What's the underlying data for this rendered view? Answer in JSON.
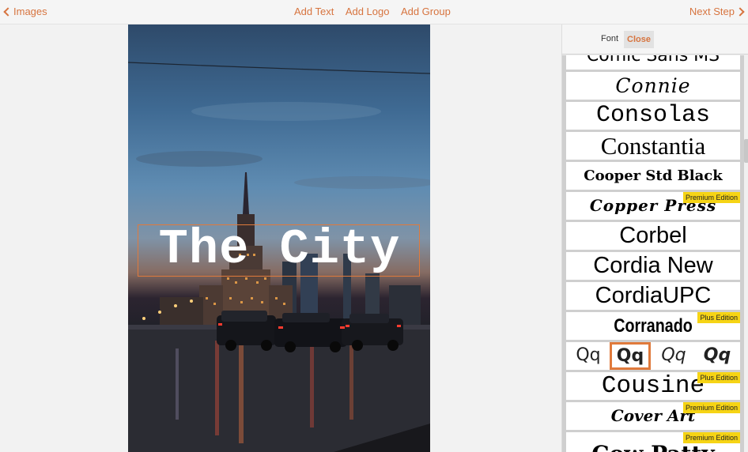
{
  "topbar": {
    "back_label": "Images",
    "actions": [
      "Add Text",
      "Add Logo",
      "Add Group"
    ],
    "next_label": "Next Step"
  },
  "canvas": {
    "text": "The City"
  },
  "panel": {
    "font_label": "Font",
    "close_label": "Close"
  },
  "fonts": [
    {
      "name": "Comic Sans MS",
      "badge": ""
    },
    {
      "name": "Connie",
      "badge": ""
    },
    {
      "name": "Consolas",
      "badge": ""
    },
    {
      "name": "Constantia",
      "badge": ""
    },
    {
      "name": "Cooper Std Black",
      "badge": ""
    },
    {
      "name": "Copper Press",
      "badge": "Premium Edition"
    },
    {
      "name": "Corbel",
      "badge": ""
    },
    {
      "name": "Cordia New",
      "badge": ""
    },
    {
      "name": "CordiaUPC",
      "badge": ""
    },
    {
      "name": "Corranado",
      "badge": "Plus Edition"
    },
    {
      "name": "Cousine",
      "badge": "Plus Edition"
    },
    {
      "name": "Cover Art",
      "badge": "Premium Edition"
    },
    {
      "name": "Cow Patty",
      "badge": "Premium Edition"
    }
  ],
  "style_options": [
    "Qq",
    "Qq",
    "Qq",
    "Qq"
  ],
  "colors": {
    "accent": "#e07a3c",
    "badge": "#f6d415"
  }
}
